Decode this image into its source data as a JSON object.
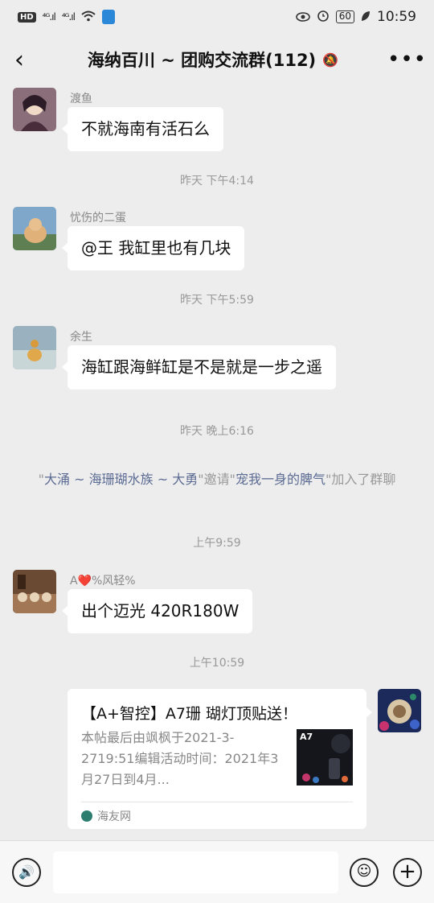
{
  "status_bar": {
    "left_tag": "HD",
    "sig1": "⁴ᴳ.ıl",
    "sig2": "⁴ᴳ.ıl",
    "battery": "60",
    "time": "10:59"
  },
  "nav": {
    "back_icon": "chevron-left-icon",
    "back_glyph": "‹",
    "title": "海纳百川 ~ 团购交流群(112)",
    "mute_glyph": "🔕",
    "more_glyph": "•••"
  },
  "messages": [
    {
      "sender": "渡鱼",
      "text": "不就海南有活石么"
    },
    {
      "sender": "忧伤的二蛋",
      "text": "@王  我缸里也有几块"
    },
    {
      "sender": "余生",
      "text": "海缸跟海鲜缸是不是就是一步之遥"
    },
    {
      "sender": "A❤️%风轻%",
      "text": "出个迈光 420R180W"
    }
  ],
  "times": {
    "t1": "昨天 下午4:14",
    "t2": "昨天 下午5:59",
    "t3": "昨天 晚上6:16",
    "t4": "上午9:59",
    "t5": "上午10:59"
  },
  "system_message": {
    "q1": "\"",
    "inviter": "大涌 ~ 海珊瑚水族 ~ 大勇",
    "q2": "\"邀请\"",
    "invitee": "宠我一身的脾气",
    "q3": "\"加入了群聊"
  },
  "card": {
    "title": "【A+智控】A7珊 瑚灯顶贴送！",
    "description": "本帖最后由飒枫于2021-3-2719:51编辑活动时间：2021年3月27日到4月...",
    "thumb_label": "A7",
    "source": "海友网"
  },
  "input_bar": {
    "voice_glyph": "🔊",
    "emoji_glyph": "☺",
    "plus_glyph": "+",
    "placeholder": ""
  }
}
